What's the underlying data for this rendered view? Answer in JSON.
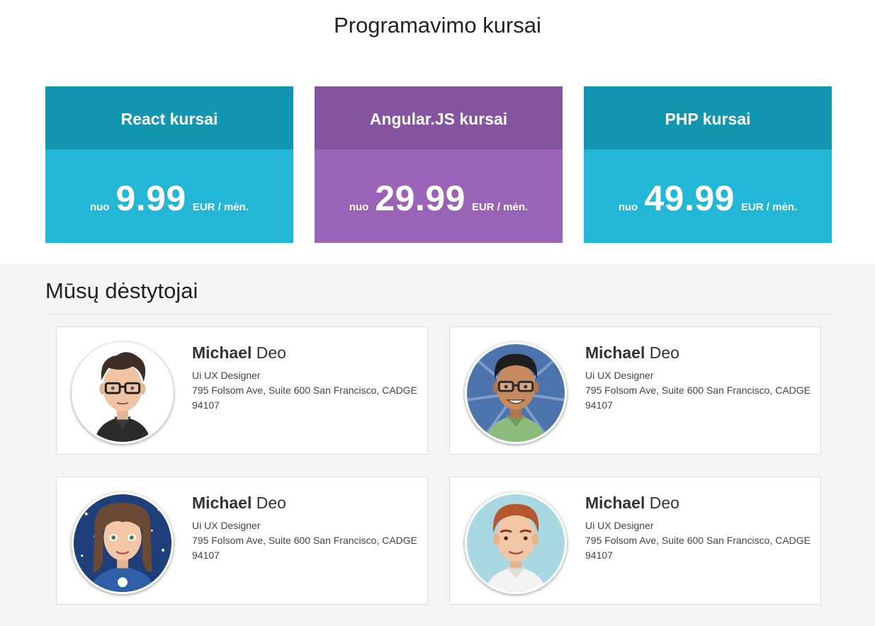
{
  "page_title": "Programavimo kursai",
  "courses": [
    {
      "title": "React kursai",
      "prefix": "nuo",
      "price": "9.99",
      "unit": "EUR / mėn.",
      "color": "#22b7d7"
    },
    {
      "title": "Angular.JS kursai",
      "prefix": "nuo",
      "price": "29.99",
      "unit": "EUR / mėn.",
      "color": "#9b63b8"
    },
    {
      "title": "PHP kursai",
      "prefix": "nuo",
      "price": "49.99",
      "unit": "EUR / mėn.",
      "color": "#22b7d7"
    }
  ],
  "team": {
    "title": "Mūsų dėstytojai",
    "members": [
      {
        "first": "Michael",
        "last": "Deo",
        "role": "Ui UX Designer",
        "address": "795 Folsom Ave, Suite 600 San Francisco, CADGE 94107",
        "avatar": "avatar-glasses-dark-hair-icon"
      },
      {
        "first": "Michael",
        "last": "Deo",
        "role": "Ui UX Designer",
        "address": "795 Folsom Ave, Suite 600 San Francisco, CADGE 94107",
        "avatar": "avatar-glasses-green-shirt-icon"
      },
      {
        "first": "Michael",
        "last": "Deo",
        "role": "Ui UX Designer",
        "address": "795 Folsom Ave, Suite 600 San Francisco, CADGE 94107",
        "avatar": "avatar-woman-starry-icon"
      },
      {
        "first": "Michael",
        "last": "Deo",
        "role": "Ui UX Designer",
        "address": "795 Folsom Ave, Suite 600 San Francisco, CADGE 94107",
        "avatar": "avatar-redhead-man-icon"
      }
    ]
  }
}
